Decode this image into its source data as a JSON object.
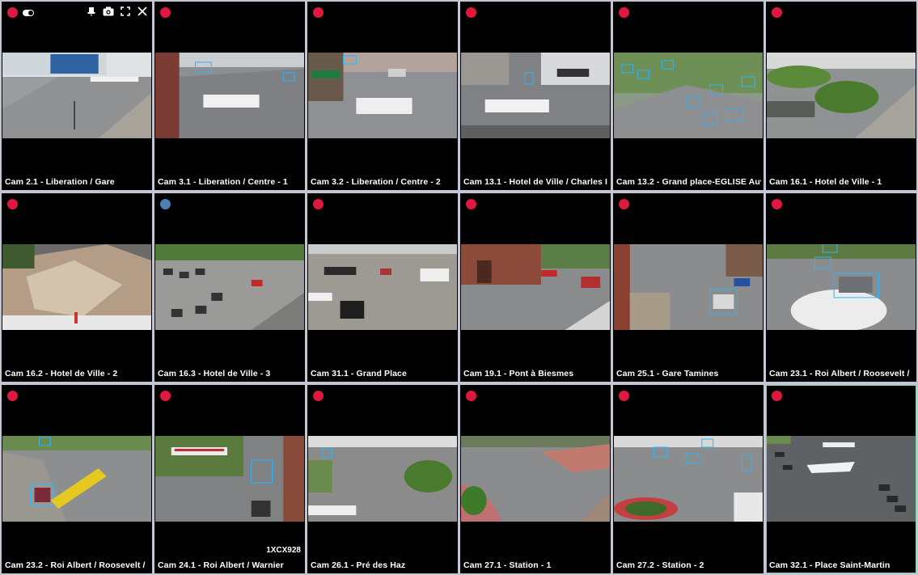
{
  "colors": {
    "record": "#e0173f",
    "record_alt": "#4a7fb8",
    "selected_border": "#7fd6a6",
    "detection_box": "#2bb6ff"
  },
  "toolbar": {
    "icons": [
      "toggle-icon",
      "pin-icon",
      "camera-icon",
      "fullscreen-icon",
      "close-icon"
    ]
  },
  "cameras": [
    {
      "label": "Cam 2.1 - Liberation / Gare"
    },
    {
      "label": "Cam 3.1 - Liberation / Centre - 1"
    },
    {
      "label": "Cam 3.2 - Liberation / Centre - 2"
    },
    {
      "label": "Cam 13.1 - Hotel de Ville / Charles I"
    },
    {
      "label": "Cam 13.2 - Grand place-EGLISE Auv"
    },
    {
      "label": "Cam 16.1 - Hotel de Ville - 1"
    },
    {
      "label": "Cam 16.2 - Hotel de Ville - 2"
    },
    {
      "label": "Cam 16.3 - Hotel de Ville - 3"
    },
    {
      "label": "Cam 31.1 - Grand Place"
    },
    {
      "label": "Cam 19.1 - Pont à Biesmes"
    },
    {
      "label": "Cam 25.1 - Gare Tamines"
    },
    {
      "label": "Cam 23.1 - Roi Albert / Roosevelt /"
    },
    {
      "label": "Cam 23.2 - Roi Albert / Roosevelt /"
    },
    {
      "label": "Cam 24.1 - Roi Albert / Warnier",
      "overlay": "1XCX928"
    },
    {
      "label": "Cam 26.1 - Pré des Haz"
    },
    {
      "label": "Cam 27.1 - Station - 1"
    },
    {
      "label": "Cam 27.2 - Station - 2"
    },
    {
      "label": "Cam 32.1 - Place Saint-Martin"
    }
  ]
}
